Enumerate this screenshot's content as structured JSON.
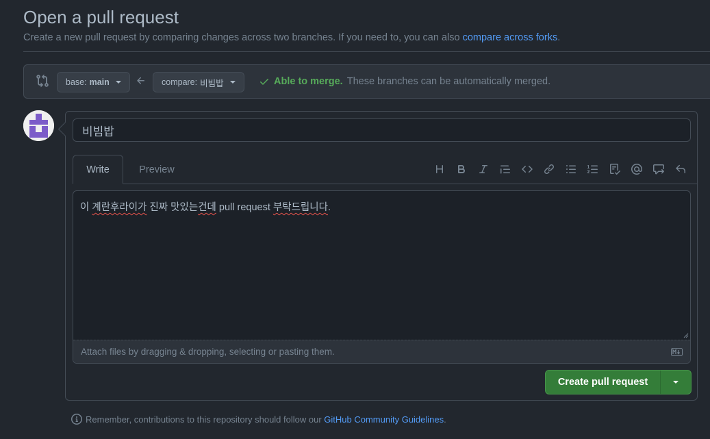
{
  "page": {
    "title": "Open a pull request",
    "subtitle": "Create a new pull request by comparing changes across two branches. If you need to, you can also ",
    "subtitle_link": "compare across forks",
    "subtitle_end": "."
  },
  "branches": {
    "base_label": "base:",
    "base_value": "main",
    "compare_label": "compare:",
    "compare_value": "비빔밥",
    "merge_ok": "Able to merge.",
    "merge_text": "These branches can be automatically merged."
  },
  "form": {
    "title_value": "비빔밥",
    "tabs": {
      "write": "Write",
      "preview": "Preview"
    },
    "body_text_a": "이 ",
    "body_text_b": "계란후라이가",
    "body_text_c": " 진짜 맛있는",
    "body_text_d": "건데",
    "body_text_e": " pull request ",
    "body_text_f": "부탁드립니다",
    "body_text_g": ".",
    "attach_text": "Attach files by dragging & dropping, selecting or pasting them.",
    "toolbar_icons": [
      "heading-icon",
      "bold-icon",
      "italic-icon",
      "quote-icon",
      "code-icon",
      "link-icon",
      "bulleted-list-icon",
      "numbered-list-icon",
      "task-list-icon",
      "mention-icon",
      "reference-icon",
      "reply-icon"
    ],
    "submit_label": "Create pull request"
  },
  "footer": {
    "text": "Remember, contributions to this repository should follow our ",
    "link": "GitHub Community Guidelines",
    "end": "."
  },
  "colors": {
    "background": "#22272e",
    "accent_link": "#539bf5",
    "success": "#57ab5a",
    "primary_button": "#347d39"
  }
}
